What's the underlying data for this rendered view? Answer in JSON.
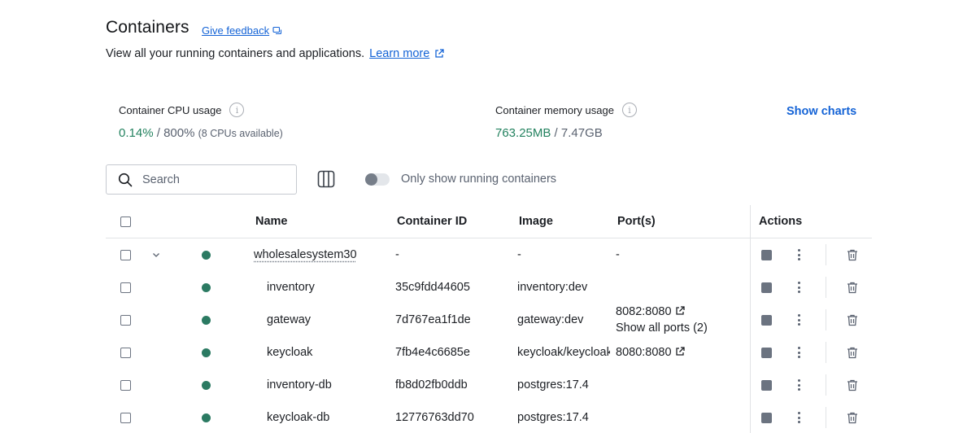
{
  "header": {
    "title": "Containers",
    "feedback_label": "Give feedback",
    "subtitle": "View all your running containers and applications.",
    "learn_more_label": "Learn more"
  },
  "stats": {
    "cpu": {
      "label": "Container CPU usage",
      "used": "0.14%",
      "separator": " / ",
      "total": "800%",
      "note": "(8 CPUs available)"
    },
    "memory": {
      "label": "Container memory usage",
      "used": "763.25MB",
      "separator": " / ",
      "total": "7.47GB"
    },
    "show_charts_label": "Show charts"
  },
  "toolbar": {
    "search_placeholder": "Search",
    "toggle_label": "Only show running containers"
  },
  "table": {
    "columns": {
      "name": "Name",
      "id": "Container ID",
      "image": "Image",
      "ports": "Port(s)",
      "actions": "Actions"
    },
    "group": {
      "name": "wholesalesystem30",
      "id": "-",
      "image": "-",
      "ports": "-"
    },
    "rows": [
      {
        "name": "inventory",
        "id": "35c9fdd44605",
        "image": "inventory:dev",
        "port": "",
        "extra": ""
      },
      {
        "name": "gateway",
        "id": "7d767ea1f1de",
        "image": "gateway:dev",
        "port": "8082:8080",
        "extra": "Show all ports (2)"
      },
      {
        "name": "keycloak",
        "id": "7fb4e4c6685e",
        "image": "keycloak/keycloak",
        "port": "8080:8080",
        "extra": ""
      },
      {
        "name": "inventory-db",
        "id": "fb8d02fb0ddb",
        "image": "postgres:17.4",
        "port": "",
        "extra": ""
      },
      {
        "name": "keycloak-db",
        "id": "12776763dd70",
        "image": "postgres:17.4",
        "port": "",
        "extra": ""
      }
    ]
  },
  "colors": {
    "accent": "#1463d6",
    "running": "#2b7a62",
    "value_green": "#23825f"
  }
}
